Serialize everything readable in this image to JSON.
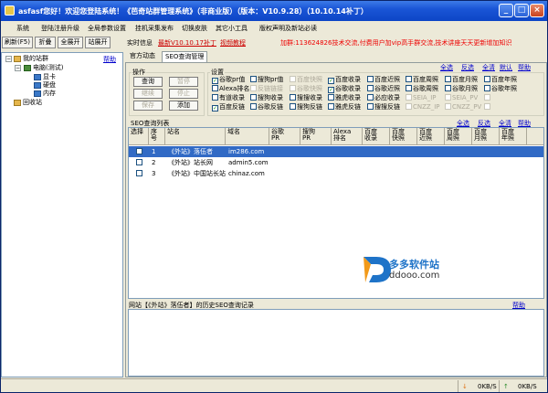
{
  "window": {
    "title": "asfasf您好！欢迎您登陆系统！《芭奇站群管理系统》（非商业版）（版本：V10.9.28）（10.10.14补丁）"
  },
  "menu": [
    "系统",
    "登陆注册升级",
    "全局参数设置",
    "挂机采集发布",
    "切换皮肤",
    "其它小工具",
    "版权声明及新站必读"
  ],
  "left": {
    "buttons": [
      "刷新(F5)",
      "折叠",
      "全展开",
      "站展开"
    ],
    "help": "帮助",
    "tree": {
      "root": "我的站群",
      "computer": "电脑(测试)",
      "items": [
        "显卡",
        "硬盘",
        "内存"
      ],
      "recycle": "回收站"
    }
  },
  "infobar": {
    "label": "实时信息",
    "version_link": "最新V10.10.17补丁",
    "video_link": "视频教程",
    "notice": "加群:113624826技术交流,付费用户加vip高手群交流,技术讲座天天更新增加知识"
  },
  "tabs": [
    "官方动态",
    "SEO查询管理"
  ],
  "ops": {
    "title": "操作",
    "buttons": [
      {
        "label": "查询",
        "enabled": true
      },
      {
        "label": "暂停",
        "enabled": false
      },
      {
        "label": "继续",
        "enabled": false
      },
      {
        "label": "停止",
        "enabled": false
      },
      {
        "label": "保存",
        "enabled": false
      },
      {
        "label": "添加",
        "enabled": true
      }
    ]
  },
  "settings": {
    "title": "设置",
    "links": [
      "全选",
      "反选",
      "全清",
      "默认",
      "帮助"
    ],
    "rows": [
      [
        {
          "l": "谷歌pr值",
          "c": true,
          "d": false
        },
        {
          "l": "搜狗pr值",
          "c": false,
          "d": false
        },
        {
          "l": "百度快照",
          "c": false,
          "d": true
        },
        {
          "l": "百度收录",
          "c": true,
          "d": false
        },
        {
          "l": "百度近照",
          "c": false,
          "d": false
        },
        {
          "l": "百度周照",
          "c": false,
          "d": false
        },
        {
          "l": "百度月照",
          "c": false,
          "d": false
        },
        {
          "l": "百度年照",
          "c": false,
          "d": false
        }
      ],
      [
        {
          "l": "Alexa排名",
          "c": false,
          "d": false
        },
        {
          "l": "反链链接",
          "c": false,
          "d": true
        },
        {
          "l": "谷歌快照",
          "c": false,
          "d": true
        },
        {
          "l": "谷歌收录",
          "c": true,
          "d": false
        },
        {
          "l": "谷歌近照",
          "c": false,
          "d": false
        },
        {
          "l": "谷歌周照",
          "c": false,
          "d": false
        },
        {
          "l": "谷歌月照",
          "c": false,
          "d": false
        },
        {
          "l": "谷歌年照",
          "c": false,
          "d": false
        }
      ],
      [
        {
          "l": "有道收录",
          "c": false,
          "d": false
        },
        {
          "l": "搜狗收录",
          "c": false,
          "d": false
        },
        {
          "l": "搜搜收录",
          "c": false,
          "d": false
        },
        {
          "l": "雅虎收录",
          "c": false,
          "d": false
        },
        {
          "l": "必应收录",
          "c": false,
          "d": false
        },
        {
          "l": "SEIA_IP",
          "c": false,
          "d": true
        },
        {
          "l": "SEIA_PV",
          "c": false,
          "d": true
        },
        {
          "l": "",
          "c": false,
          "d": true
        }
      ],
      [
        {
          "l": "百度反链",
          "c": true,
          "d": false
        },
        {
          "l": "谷歌反链",
          "c": false,
          "d": false
        },
        {
          "l": "搜狗反链",
          "c": false,
          "d": false
        },
        {
          "l": "雅虎反链",
          "c": false,
          "d": false
        },
        {
          "l": "搜搜反链",
          "c": false,
          "d": false
        },
        {
          "l": "CNZZ_IP",
          "c": false,
          "d": true
        },
        {
          "l": "CNZZ_PV",
          "c": false,
          "d": true
        },
        {
          "l": "",
          "c": false,
          "d": true
        }
      ]
    ]
  },
  "seo_list": {
    "title": "SEO查询列表",
    "links": [
      "全选",
      "反选",
      "全清",
      "帮助"
    ],
    "columns": [
      "选择",
      "序号",
      "站名",
      "域名",
      "谷歌\nPR",
      "搜狗\nPR",
      "Alexa\n排名",
      "百度\n收录",
      "百度\n快照",
      "百度\n近照",
      "百度\n周照",
      "百度\n月照",
      "百度\n年照"
    ],
    "rows": [
      {
        "no": "1",
        "name": "《外站》落伍者",
        "domain": "im286.com",
        "selected": true
      },
      {
        "no": "2",
        "name": "《外站》站长网",
        "domain": "admin5.com",
        "selected": false
      },
      {
        "no": "3",
        "name": "《外站》中国站长站",
        "domain": "chinaz.com",
        "selected": false
      }
    ]
  },
  "history": {
    "label": "网站【《外站》落伍者】的历史SEO查询记录",
    "help": "帮助"
  },
  "watermark": {
    "cn": "多多软件站",
    "url": "ddooo.com"
  },
  "status": {
    "down": "0KB/S",
    "up": "0KB/S"
  }
}
